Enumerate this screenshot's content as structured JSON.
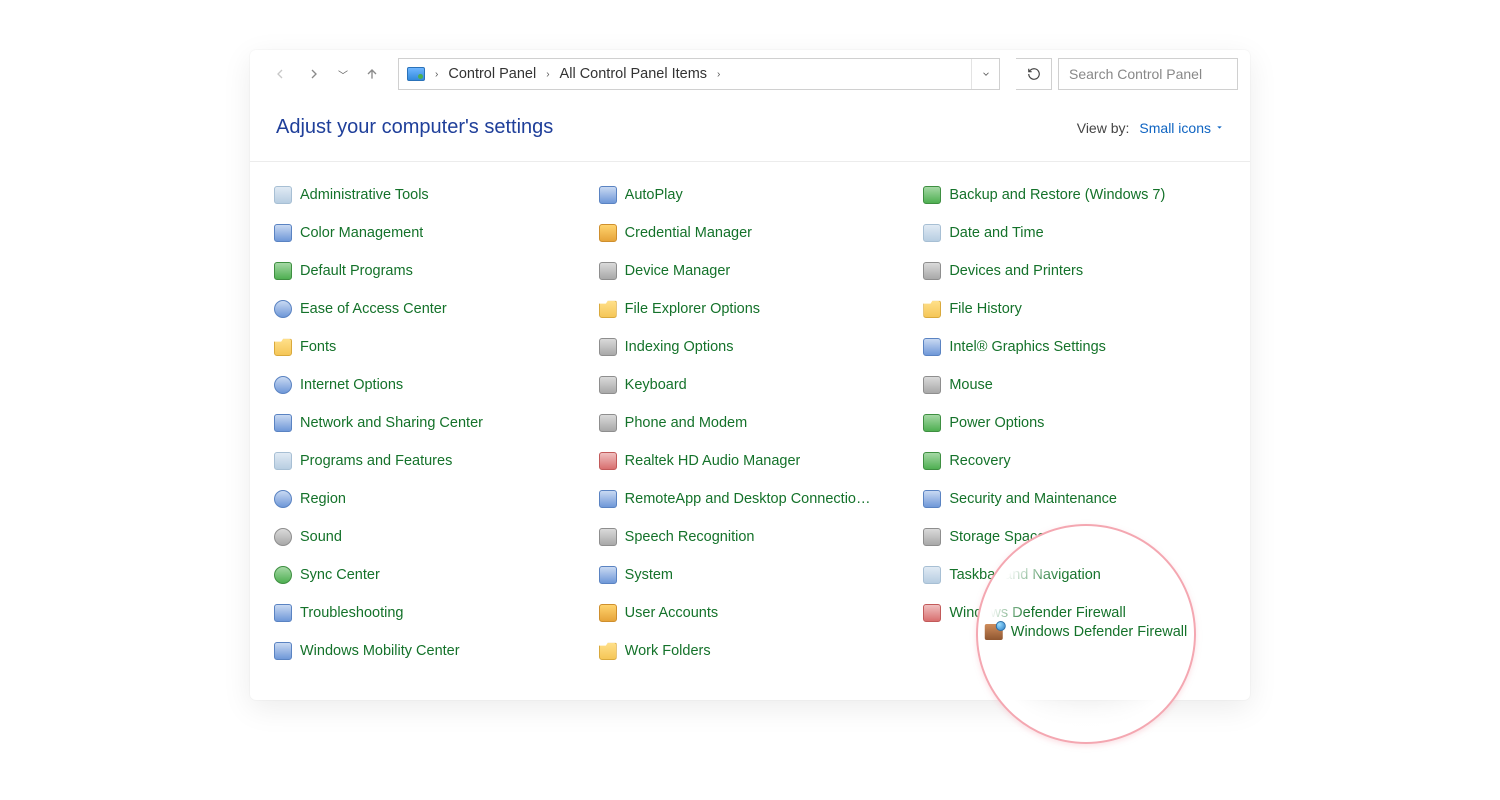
{
  "nav": {
    "recent_tooltip": "Recent locations",
    "up_tooltip": "Up"
  },
  "breadcrumbs": {
    "root": "Control Panel",
    "current": "All Control Panel Items"
  },
  "toolbar": {
    "refresh_tooltip": "Refresh"
  },
  "search": {
    "placeholder": "Search Control Panel"
  },
  "header": {
    "title": "Adjust your computer's settings",
    "viewby_label": "View by:",
    "viewby_value": "Small icons"
  },
  "highlight": {
    "label": "Windows Defender Firewall"
  },
  "items": [
    {
      "label": "Administrative Tools",
      "icon": "ic-a"
    },
    {
      "label": "AutoPlay",
      "icon": "ic-d"
    },
    {
      "label": "Backup and Restore (Windows 7)",
      "icon": "ic-c"
    },
    {
      "label": "Color Management",
      "icon": "ic-d"
    },
    {
      "label": "Credential Manager",
      "icon": "ic-b"
    },
    {
      "label": "Date and Time",
      "icon": "ic-a"
    },
    {
      "label": "Default Programs",
      "icon": "ic-c"
    },
    {
      "label": "Device Manager",
      "icon": "ic-g"
    },
    {
      "label": "Devices and Printers",
      "icon": "ic-g"
    },
    {
      "label": "Ease of Access Center",
      "icon": "ic-d ic-round"
    },
    {
      "label": "File Explorer Options",
      "icon": "ic-folder"
    },
    {
      "label": "File History",
      "icon": "ic-folder"
    },
    {
      "label": "Fonts",
      "icon": "ic-folder"
    },
    {
      "label": "Indexing Options",
      "icon": "ic-g"
    },
    {
      "label": "Intel® Graphics Settings",
      "icon": "ic-d"
    },
    {
      "label": "Internet Options",
      "icon": "ic-d ic-round"
    },
    {
      "label": "Keyboard",
      "icon": "ic-g"
    },
    {
      "label": "Mouse",
      "icon": "ic-g"
    },
    {
      "label": "Network and Sharing Center",
      "icon": "ic-d"
    },
    {
      "label": "Phone and Modem",
      "icon": "ic-g"
    },
    {
      "label": "Power Options",
      "icon": "ic-c"
    },
    {
      "label": "Programs and Features",
      "icon": "ic-a"
    },
    {
      "label": "Realtek HD Audio Manager",
      "icon": "ic-e"
    },
    {
      "label": "Recovery",
      "icon": "ic-c"
    },
    {
      "label": "Region",
      "icon": "ic-d ic-round"
    },
    {
      "label": "RemoteApp and Desktop Connectio…",
      "icon": "ic-d"
    },
    {
      "label": "Security and Maintenance",
      "icon": "ic-d"
    },
    {
      "label": "Sound",
      "icon": "ic-g ic-round"
    },
    {
      "label": "Speech Recognition",
      "icon": "ic-g"
    },
    {
      "label": "Storage Spaces",
      "icon": "ic-g"
    },
    {
      "label": "Sync Center",
      "icon": "ic-c ic-round"
    },
    {
      "label": "System",
      "icon": "ic-d"
    },
    {
      "label": "Taskbar and Navigation",
      "icon": "ic-a"
    },
    {
      "label": "Troubleshooting",
      "icon": "ic-d"
    },
    {
      "label": "User Accounts",
      "icon": "ic-b"
    },
    {
      "label": "Windows Defender Firewall",
      "icon": "ic-e"
    },
    {
      "label": "Windows Mobility Center",
      "icon": "ic-d"
    },
    {
      "label": "Work Folders",
      "icon": "ic-folder"
    },
    {
      "label": "",
      "icon": ""
    }
  ]
}
